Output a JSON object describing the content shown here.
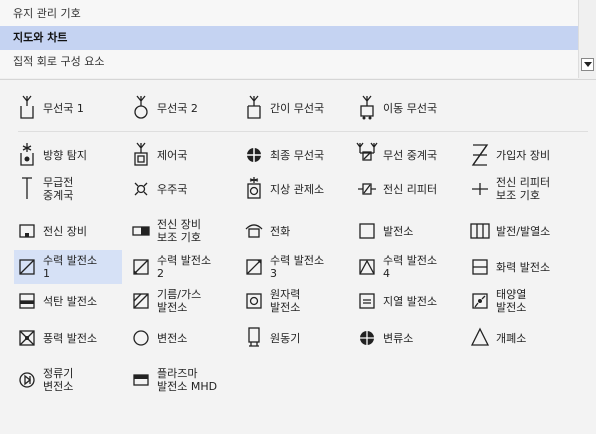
{
  "categories": [
    {
      "label": "유지 관리 기호",
      "selected": false
    },
    {
      "label": "지도와 차트",
      "selected": true
    },
    {
      "label": "집적 회로 구성 요소",
      "selected": false
    }
  ],
  "scroll_button": "chevron-down-icon",
  "groups": [
    [
      {
        "label": "무선국 1",
        "icon": "radio-station-1-icon"
      },
      {
        "label": "무선국 2",
        "icon": "radio-station-2-icon"
      },
      {
        "label": "간이 무선국",
        "icon": "simple-radio-station-icon"
      },
      {
        "label": "이동 무선국",
        "icon": "mobile-radio-station-icon"
      }
    ],
    [
      {
        "label": "방향 탐지",
        "icon": "direction-finding-icon"
      },
      {
        "label": "제어국",
        "icon": "control-station-icon"
      },
      {
        "label": "최종 무선국",
        "icon": "terminal-radio-station-icon"
      },
      {
        "label": "무선 중계국",
        "icon": "radio-relay-station-icon"
      },
      {
        "label": "가입자 장비",
        "icon": "subscriber-equipment-icon"
      },
      {
        "label": "무급전\n중계국",
        "icon": "passive-repeater-icon"
      },
      {
        "label": "우주국",
        "icon": "space-station-icon"
      },
      {
        "label": "지상 관제소",
        "icon": "ground-control-icon"
      },
      {
        "label": "전신 리피터",
        "icon": "telegraph-repeater-icon"
      },
      {
        "label": "전신 리피터\n보조 기호",
        "icon": "telegraph-repeater-aux-icon"
      },
      {
        "label": "전신 장비",
        "icon": "telegraph-equipment-icon"
      },
      {
        "label": "전신 장비\n보조 기호",
        "icon": "telegraph-equipment-aux-icon"
      },
      {
        "label": "전화",
        "icon": "telephone-icon"
      },
      {
        "label": "발전소",
        "icon": "power-plant-icon"
      },
      {
        "label": "발전/발열소",
        "icon": "power-heat-plant-icon"
      },
      {
        "label": "수력 발전소\n1",
        "icon": "hydro-plant-1-icon",
        "selected": true
      },
      {
        "label": "수력 발전소\n2",
        "icon": "hydro-plant-2-icon"
      },
      {
        "label": "수력 발전소\n3",
        "icon": "hydro-plant-3-icon"
      },
      {
        "label": "수력 발전소\n4",
        "icon": "hydro-plant-4-icon"
      },
      {
        "label": "화력 발전소",
        "icon": "thermal-plant-icon"
      },
      {
        "label": "석탄 발전소",
        "icon": "coal-plant-icon"
      },
      {
        "label": "기름/가스\n발전소",
        "icon": "oil-gas-plant-icon"
      },
      {
        "label": "원자력\n발전소",
        "icon": "nuclear-plant-icon"
      },
      {
        "label": "지열 발전소",
        "icon": "geothermal-plant-icon"
      },
      {
        "label": "태양열\n발전소",
        "icon": "solar-plant-icon"
      },
      {
        "label": "풍력 발전소",
        "icon": "wind-plant-icon"
      },
      {
        "label": "변전소",
        "icon": "substation-icon"
      },
      {
        "label": "원동기",
        "icon": "prime-mover-icon"
      },
      {
        "label": "변류소",
        "icon": "converter-station-icon"
      },
      {
        "label": "개폐소",
        "icon": "switching-station-icon"
      },
      {
        "label": "정류기\n변전소",
        "icon": "rectifier-substation-icon"
      },
      {
        "label": "플라즈마\n발전소 MHD",
        "icon": "plasma-mhd-plant-icon"
      }
    ]
  ]
}
